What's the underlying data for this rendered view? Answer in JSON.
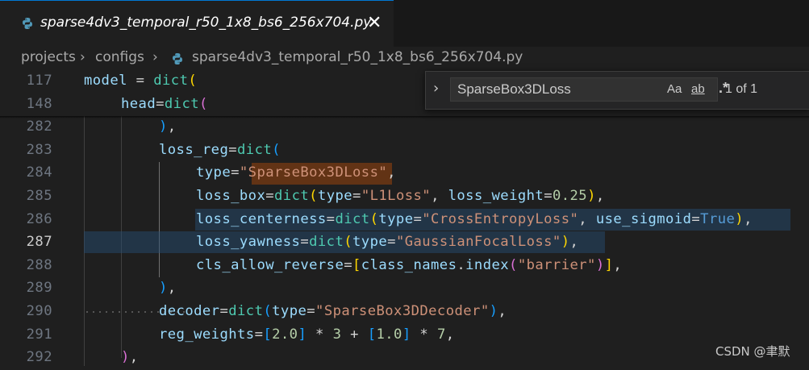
{
  "tab": {
    "filename": "sparse4dv3_temporal_r50_1x8_bs6_256x704.py",
    "close_glyph": "✕"
  },
  "breadcrumb": {
    "part1": "projects",
    "sep": "›",
    "part2": "configs",
    "file": "sparse4dv3_temporal_r50_1x8_bs6_256x704.py"
  },
  "find": {
    "query": "SparseBox3DLoss",
    "match_case": "Aa",
    "whole_word": "ab",
    "regex": ".*",
    "count": "1 of 1"
  },
  "lines": {
    "l117": "117",
    "l148": "148",
    "l282": "282",
    "l283": "283",
    "l284": "284",
    "l285": "285",
    "l286": "286",
    "l287": "287",
    "l288": "288",
    "l289": "289",
    "l290": "290",
    "l291": "291",
    "l292": "292"
  },
  "code": {
    "model": "model",
    "dict": "dict",
    "head": "head",
    "loss_reg": "loss_reg",
    "type": "type",
    "s_sbl": "\"SparseBox3DLoss\"",
    "loss_box": "loss_box",
    "s_l1": "\"L1Loss\"",
    "loss_weight": "loss_weight",
    "n025": "0.25",
    "loss_centerness": "loss_centerness",
    "s_ce": "\"CrossEntropyLoss\"",
    "use_sigmoid": "use_sigmoid",
    "true_kw": "True",
    "loss_yawness": "loss_yawness",
    "s_gfl": "\"GaussianFocalLoss\"",
    "cls_allow_reverse": "cls_allow_reverse",
    "class_names": "class_names",
    "index": "index",
    "s_barrier": "\"barrier\"",
    "decoder": "decoder",
    "s_dec": "\"SparseBox3DDecoder\"",
    "reg_weights": "reg_weights",
    "n20": "2.0",
    "n3": "3",
    "n10": "1.0",
    "n7": "7"
  },
  "watermark": "CSDN @聿默",
  "colors": {
    "background": "#1f1f1f",
    "tab_accent": "#0078d4",
    "find_highlight": "#623315",
    "selection": "#264f78"
  }
}
